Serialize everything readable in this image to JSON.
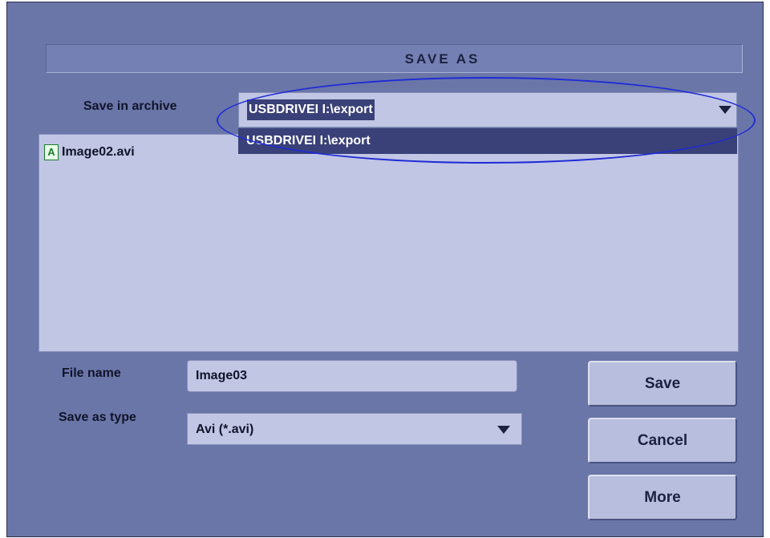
{
  "dialog": {
    "title": "SAVE AS"
  },
  "archive": {
    "label": "Save in archive",
    "selected": "USBDRIVEI  I:\\export",
    "options": [
      "USBDRIVEI  I:\\export"
    ]
  },
  "file_list": {
    "items": [
      {
        "icon": "avi-file-icon",
        "icon_glyph": "A",
        "name": "Image02.avi"
      }
    ]
  },
  "file_name": {
    "label": "File name",
    "value": "Image03"
  },
  "save_type": {
    "label": "Save as type",
    "value": "Avi  (*.avi)"
  },
  "buttons": {
    "save": "Save",
    "cancel": "Cancel",
    "more": "More"
  },
  "colors": {
    "dialog_bg": "#6a76a8",
    "field_bg": "#c0c6e4",
    "selection": "#3a4178",
    "annotation": "#1f2ad6"
  }
}
